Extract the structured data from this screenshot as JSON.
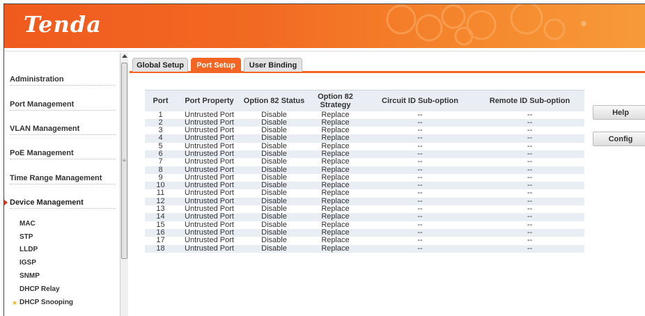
{
  "brand": {
    "logo": "Tenda"
  },
  "sidebar": {
    "items": [
      {
        "label": "Administration"
      },
      {
        "label": "Port Management"
      },
      {
        "label": "VLAN Management"
      },
      {
        "label": "PoE Management"
      },
      {
        "label": "Time Range Management"
      },
      {
        "label": "Device Management",
        "active": true
      }
    ],
    "subitems": [
      {
        "label": "MAC"
      },
      {
        "label": "STP"
      },
      {
        "label": "LLDP"
      },
      {
        "label": "IGSP"
      },
      {
        "label": "SNMP"
      },
      {
        "label": "DHCP Relay"
      },
      {
        "label": "DHCP Snooping",
        "active": true
      }
    ]
  },
  "tabs": [
    {
      "label": "Global Setup"
    },
    {
      "label": "Port Setup",
      "active": true
    },
    {
      "label": "User Binding"
    }
  ],
  "table": {
    "headers": [
      "Port",
      "Port Property",
      "Option 82 Status",
      "Option 82 Strategy",
      "Circuit ID Sub-option",
      "Remote ID Sub-option"
    ],
    "rows": [
      [
        "1",
        "Untrusted Port",
        "Disable",
        "Replace",
        "--",
        "--"
      ],
      [
        "2",
        "Untrusted Port",
        "Disable",
        "Replace",
        "--",
        "--"
      ],
      [
        "3",
        "Untrusted Port",
        "Disable",
        "Replace",
        "--",
        "--"
      ],
      [
        "4",
        "Untrusted Port",
        "Disable",
        "Replace",
        "--",
        "--"
      ],
      [
        "5",
        "Untrusted Port",
        "Disable",
        "Replace",
        "--",
        "--"
      ],
      [
        "6",
        "Untrusted Port",
        "Disable",
        "Replace",
        "--",
        "--"
      ],
      [
        "7",
        "Untrusted Port",
        "Disable",
        "Replace",
        "--",
        "--"
      ],
      [
        "8",
        "Untrusted Port",
        "Disable",
        "Replace",
        "--",
        "--"
      ],
      [
        "9",
        "Untrusted Port",
        "Disable",
        "Replace",
        "--",
        "--"
      ],
      [
        "10",
        "Untrusted Port",
        "Disable",
        "Replace",
        "--",
        "--"
      ],
      [
        "11",
        "Untrusted Port",
        "Disable",
        "Replace",
        "--",
        "--"
      ],
      [
        "12",
        "Untrusted Port",
        "Disable",
        "Replace",
        "--",
        "--"
      ],
      [
        "13",
        "Untrusted Port",
        "Disable",
        "Replace",
        "--",
        "--"
      ],
      [
        "14",
        "Untrusted Port",
        "Disable",
        "Replace",
        "--",
        "--"
      ],
      [
        "15",
        "Untrusted Port",
        "Disable",
        "Replace",
        "--",
        "--"
      ],
      [
        "16",
        "Untrusted Port",
        "Disable",
        "Replace",
        "--",
        "--"
      ],
      [
        "17",
        "Untrusted Port",
        "Disable",
        "Replace",
        "--",
        "--"
      ],
      [
        "18",
        "Untrusted Port",
        "Disable",
        "Replace",
        "--",
        "--"
      ]
    ]
  },
  "buttons": {
    "help": "Help",
    "config": "Config"
  },
  "colors": {
    "accent": "#f26522",
    "row_alt": "#e9eef5"
  }
}
